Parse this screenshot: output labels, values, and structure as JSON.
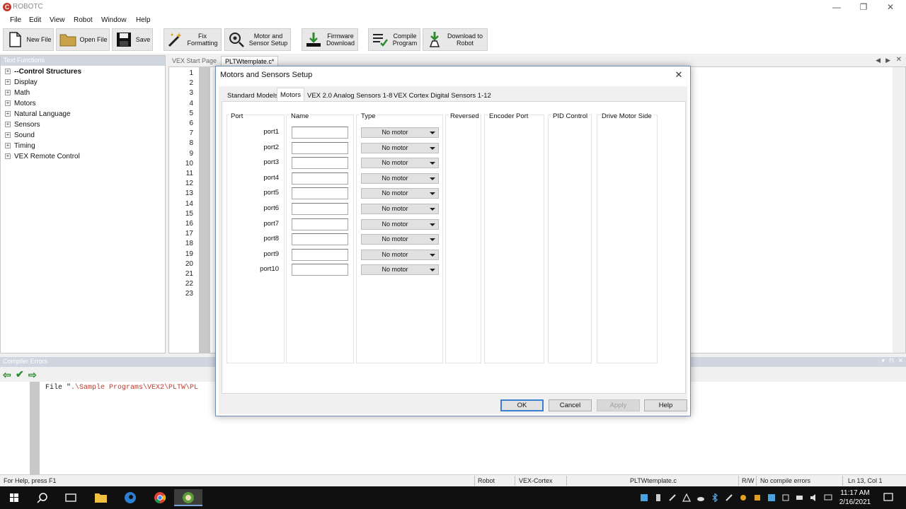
{
  "window": {
    "title": "ROBOTC",
    "minimize": "—",
    "restore": "❐",
    "close": "✕"
  },
  "menu": [
    "File",
    "Edit",
    "View",
    "Robot",
    "Window",
    "Help"
  ],
  "toolbar": [
    {
      "label": "New File",
      "icon": "new-file-icon"
    },
    {
      "label": "Open File",
      "icon": "folder-icon"
    },
    {
      "label": "Save",
      "icon": "floppy-icon"
    },
    {
      "label": "Fix\nFormatting",
      "icon": "magic-wand-icon"
    },
    {
      "label": "Motor and\nSensor Setup",
      "icon": "motor-sensor-icon"
    },
    {
      "label": "Firmware\nDownload",
      "icon": "firmware-icon"
    },
    {
      "label": "Compile\nProgram",
      "icon": "compile-icon"
    },
    {
      "label": "Download to\nRobot",
      "icon": "download-robot-icon"
    }
  ],
  "text_functions": {
    "title": "Text Functions",
    "items": [
      "--Control Structures",
      "Display",
      "Math",
      "Motors",
      "Natural Language",
      "Sensors",
      "Sound",
      "Timing",
      "VEX Remote Control"
    ]
  },
  "doc_tabs": [
    "VEX Start Page",
    "PLTWtemplate.c*"
  ],
  "editor": {
    "line_numbers": [
      "1",
      "2",
      "3",
      "4",
      "5",
      "6",
      "7",
      "8",
      "9",
      "10",
      "11",
      "12",
      "13",
      "14",
      "15",
      "16",
      "17",
      "18",
      "19",
      "20",
      "21",
      "22",
      "23"
    ]
  },
  "compiler": {
    "title": "Compiler Errors",
    "line_prefix": "File \"",
    "line_path": ".\\Sample Programs\\VEX2\\PLTW\\PL"
  },
  "dialog": {
    "title": "Motors and Sensors Setup",
    "tabs": [
      "Standard Models",
      "Motors",
      "VEX 2.0 Analog Sensors 1-8",
      "VEX Cortex Digital Sensors 1-12"
    ],
    "active_tab": "Motors",
    "columns": [
      "Port",
      "Name",
      "Type",
      "Reversed",
      "Encoder Port",
      "PID Control",
      "Drive Motor Side"
    ],
    "ports": [
      {
        "port": "port1",
        "name": "",
        "type": "No motor"
      },
      {
        "port": "port2",
        "name": "",
        "type": "No motor"
      },
      {
        "port": "port3",
        "name": "",
        "type": "No motor"
      },
      {
        "port": "port4",
        "name": "",
        "type": "No motor"
      },
      {
        "port": "port5",
        "name": "",
        "type": "No motor"
      },
      {
        "port": "port6",
        "name": "",
        "type": "No motor"
      },
      {
        "port": "port7",
        "name": "",
        "type": "No motor"
      },
      {
        "port": "port8",
        "name": "",
        "type": "No motor"
      },
      {
        "port": "port9",
        "name": "",
        "type": "No motor"
      },
      {
        "port": "port10",
        "name": "",
        "type": "No motor"
      }
    ],
    "buttons": {
      "ok": "OK",
      "cancel": "Cancel",
      "apply": "Apply",
      "help": "Help"
    }
  },
  "status": {
    "help": "For Help, press F1",
    "robot": "Robot",
    "platform": "VEX-Cortex",
    "file": "PLTWtemplate.c",
    "rw": "R/W",
    "errors": "No compile errors",
    "position": "Ln 13, Col 1"
  },
  "taskbar": {
    "time": "11:17 AM",
    "date": "2/16/2021"
  },
  "colors": {
    "accent": "#3c7fd1",
    "panel_head": "#cfd6e0",
    "error_path": "#c0392b"
  }
}
